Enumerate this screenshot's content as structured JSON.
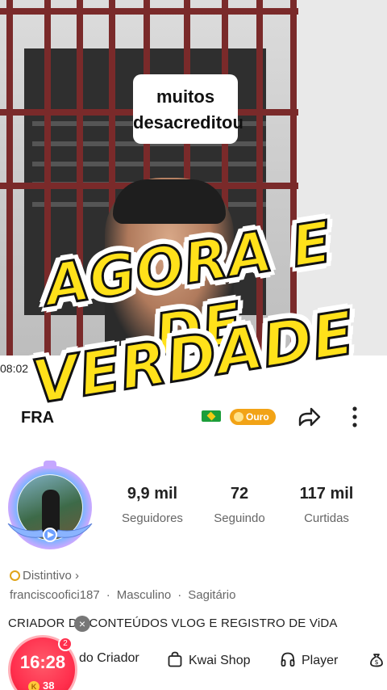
{
  "video": {
    "caption": "muitos\ndesacreditou",
    "timestamp": "08:02",
    "overlay_line1": "AGORA E DE",
    "overlay_line2": "VERDADE"
  },
  "profile": {
    "username_visible": "FRA",
    "level_badge": "Ouro",
    "followers_value": "9,9 mil",
    "followers_label": "Seguidores",
    "following_value": "72",
    "following_label": "Seguindo",
    "likes_value": "117 mil",
    "likes_label": "Curtidas",
    "badge_link": "Distintivo",
    "handle": "franciscoofici187",
    "gender": "Masculino",
    "zodiac": "Sagitário",
    "bio": "CRIADOR DE CONTEÚDOS VLOG E REGISTRO DE  ViDA"
  },
  "links": {
    "creator": "do Criador",
    "shop": "Kwai Shop",
    "player": "Player"
  },
  "float_widget": {
    "time": "16:28",
    "coins": "38",
    "notification_count": "2",
    "close_symbol": "×",
    "coin_symbol": "K"
  },
  "icons": [
    "share-icon",
    "more-icon",
    "shopping-bag-icon",
    "headphones-icon",
    "money-bag-icon",
    "close-icon"
  ],
  "colors": {
    "overlay_yellow": "#ffe11a",
    "badge_orange": "#f2a316",
    "widget_red": "#ff2f4d"
  }
}
